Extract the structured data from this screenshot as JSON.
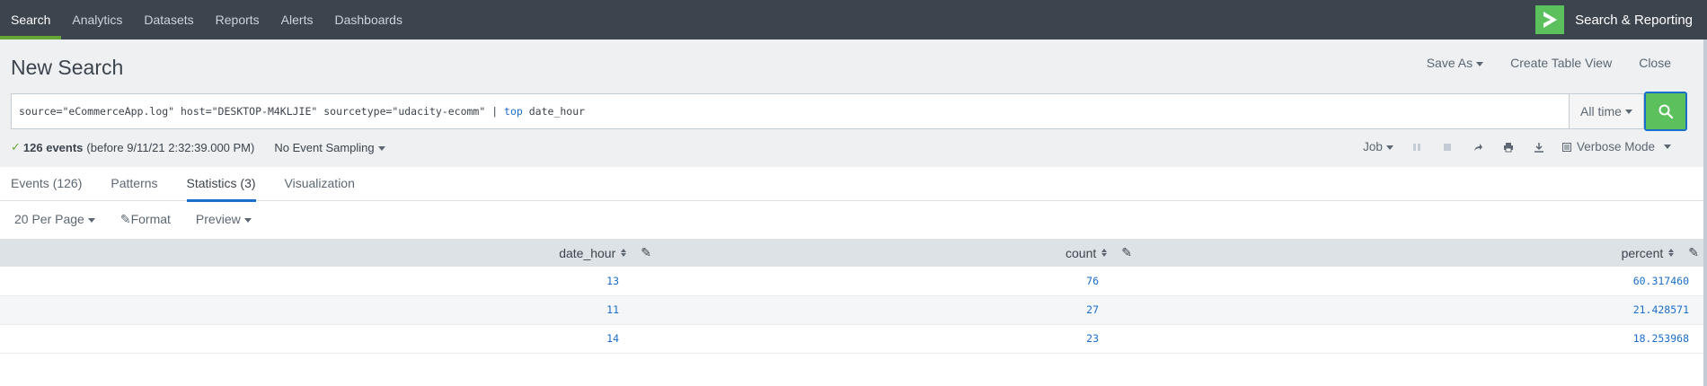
{
  "nav": {
    "items": [
      {
        "label": "Search",
        "active": true
      },
      {
        "label": "Analytics",
        "active": false
      },
      {
        "label": "Datasets",
        "active": false
      },
      {
        "label": "Reports",
        "active": false
      },
      {
        "label": "Alerts",
        "active": false
      },
      {
        "label": "Dashboards",
        "active": false
      }
    ],
    "app_title": "Search & Reporting",
    "app_logo_icon": "splunk-chevron-logo"
  },
  "header": {
    "title": "New Search",
    "save_as": "Save As",
    "create_table_view": "Create Table View",
    "close": "Close"
  },
  "search": {
    "query_prefix": "source=\"eCommerceApp.log\" host=\"DESKTOP-M4KLJIE\" sourcetype=\"udacity-ecomm\" | ",
    "query_command": "top",
    "query_suffix": " date_hour",
    "time_range": "All time",
    "submit_icon": "magnifier-icon"
  },
  "status": {
    "check": "✓",
    "events_count": "126 events",
    "events_detail": "(before 9/11/21 2:32:39.000 PM)",
    "sampling": "No Event Sampling"
  },
  "job": {
    "job_label": "Job",
    "mode": "Verbose Mode"
  },
  "tabs": [
    {
      "label": "Events (126)",
      "active": false
    },
    {
      "label": "Patterns",
      "active": false
    },
    {
      "label": "Statistics (3)",
      "active": true
    },
    {
      "label": "Visualization",
      "active": false
    }
  ],
  "options": {
    "per_page": "20 Per Page",
    "format": "Format",
    "preview": "Preview"
  },
  "table": {
    "columns": [
      "date_hour",
      "count",
      "percent"
    ],
    "rows": [
      [
        "13",
        "76",
        "60.317460"
      ],
      [
        "11",
        "27",
        "21.428571"
      ],
      [
        "14",
        "23",
        "18.253968"
      ]
    ]
  },
  "colors": {
    "nav_bg": "#3c444d",
    "accent_green": "#5cc05c",
    "link_blue": "#1a6ec9",
    "header_gray": "#eef0f2"
  }
}
